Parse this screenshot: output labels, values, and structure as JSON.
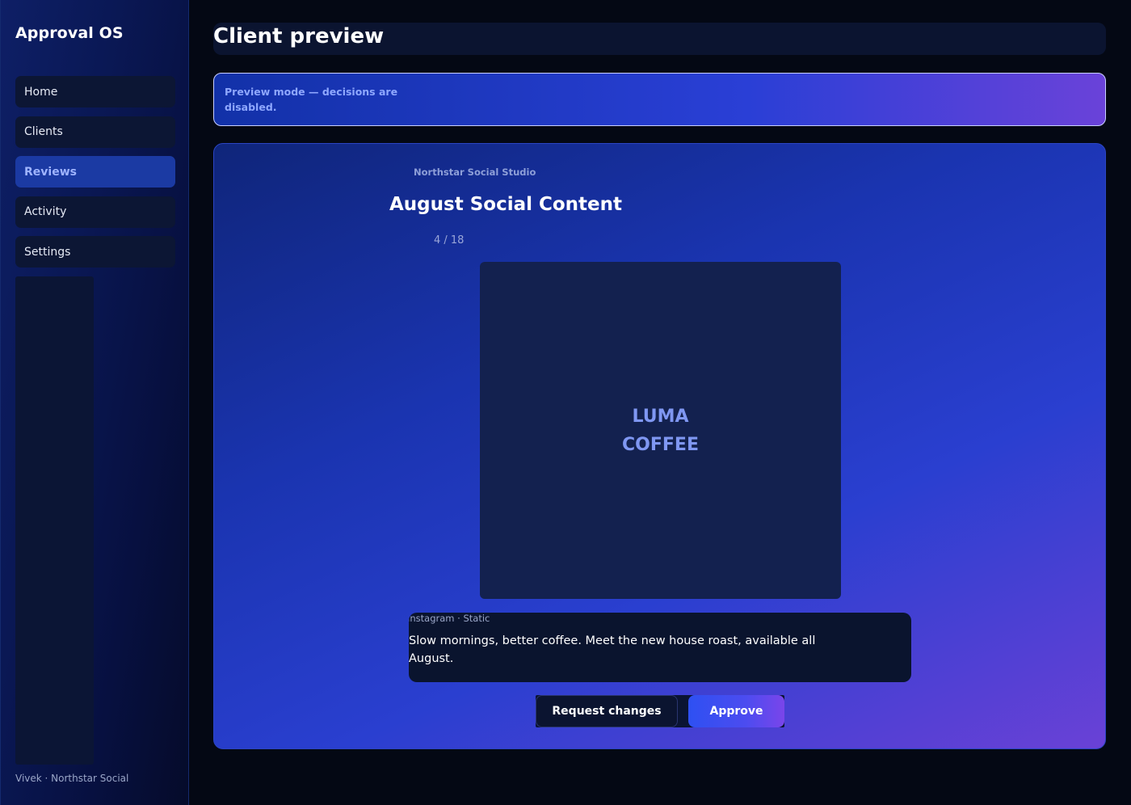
{
  "app": {
    "name": "Approval OS"
  },
  "sidebar": {
    "items": [
      {
        "label": "Home",
        "active": false
      },
      {
        "label": "Clients",
        "active": false
      },
      {
        "label": "Reviews",
        "active": true
      },
      {
        "label": "Activity",
        "active": false
      },
      {
        "label": "Settings",
        "active": false
      }
    ],
    "user": "Vivek · Northstar Social"
  },
  "header": {
    "title": "Client preview"
  },
  "banner": {
    "text": "Preview mode — decisions are disabled."
  },
  "review": {
    "client": "Northstar Social Studio",
    "title": "August Social Content",
    "counter": "4 / 18",
    "asset_lines": [
      "LUMA",
      "COFFEE"
    ],
    "meta": "Instagram · Static",
    "caption": "Slow mornings, better coffee. Meet the new house roast, available all August.",
    "actions": {
      "request_label": "Request changes",
      "approve_label": "Approve"
    }
  },
  "colors": {
    "accent": "#2e50f2",
    "active_nav_bg": "#1b3aa3",
    "active_nav_text": "#9fb4ff",
    "banner_text": "#8fa8ff"
  }
}
